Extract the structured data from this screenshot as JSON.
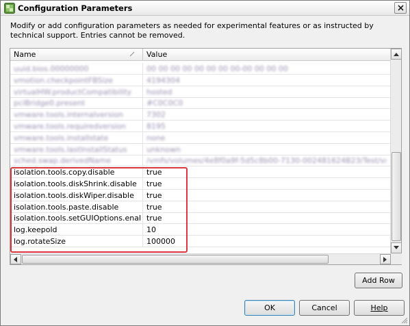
{
  "window": {
    "title": "Configuration Parameters"
  },
  "description": "Modify or add configuration parameters as needed for experimental features or as instructed by technical support. Entries cannot be removed.",
  "grid": {
    "columns": {
      "name": "Name",
      "value": "Value"
    },
    "blurred_rows": [
      {
        "name": "uuid.bios.00000000",
        "value": "00 00 00 00 00 00 00 00-00 00 00 00"
      },
      {
        "name": "vmotion.checkpointFBSize",
        "value": "4194304"
      },
      {
        "name": "virtualHW.productCompatibility",
        "value": "hosted"
      },
      {
        "name": "pciBridge0.present",
        "value": "#C0C0C0"
      },
      {
        "name": "vmware.tools.internalversion",
        "value": "7302"
      },
      {
        "name": "vmware.tools.requiredversion",
        "value": "8195"
      },
      {
        "name": "vmware.tools.installstate",
        "value": "none"
      },
      {
        "name": "vmware.tools.lastInstallStatus",
        "value": "unknown"
      },
      {
        "name": "sched.swap.derivedName",
        "value": "/vmfs/volumes/4e8f0a9f-5d5c8b00-7130-002481624B23/Test/vm/Test"
      }
    ],
    "rows": [
      {
        "name": "isolation.tools.copy.disable",
        "value": "true"
      },
      {
        "name": "isolation.tools.diskShrink.disable",
        "value": "true"
      },
      {
        "name": "isolation.tools.diskWiper.disable",
        "value": "true"
      },
      {
        "name": "isolation.tools.paste.disable",
        "value": "true"
      },
      {
        "name": "isolation.tools.setGUIOptions.enable",
        "value": "true"
      },
      {
        "name": "log.keepold",
        "value": "10"
      },
      {
        "name": "log.rotateSize",
        "value": "100000"
      }
    ]
  },
  "buttons": {
    "add_row": "Add Row",
    "ok": "OK",
    "cancel": "Cancel",
    "help": "Help"
  },
  "colors": {
    "highlight": "#d9363e",
    "blurred_text": "#9a8fb0"
  }
}
